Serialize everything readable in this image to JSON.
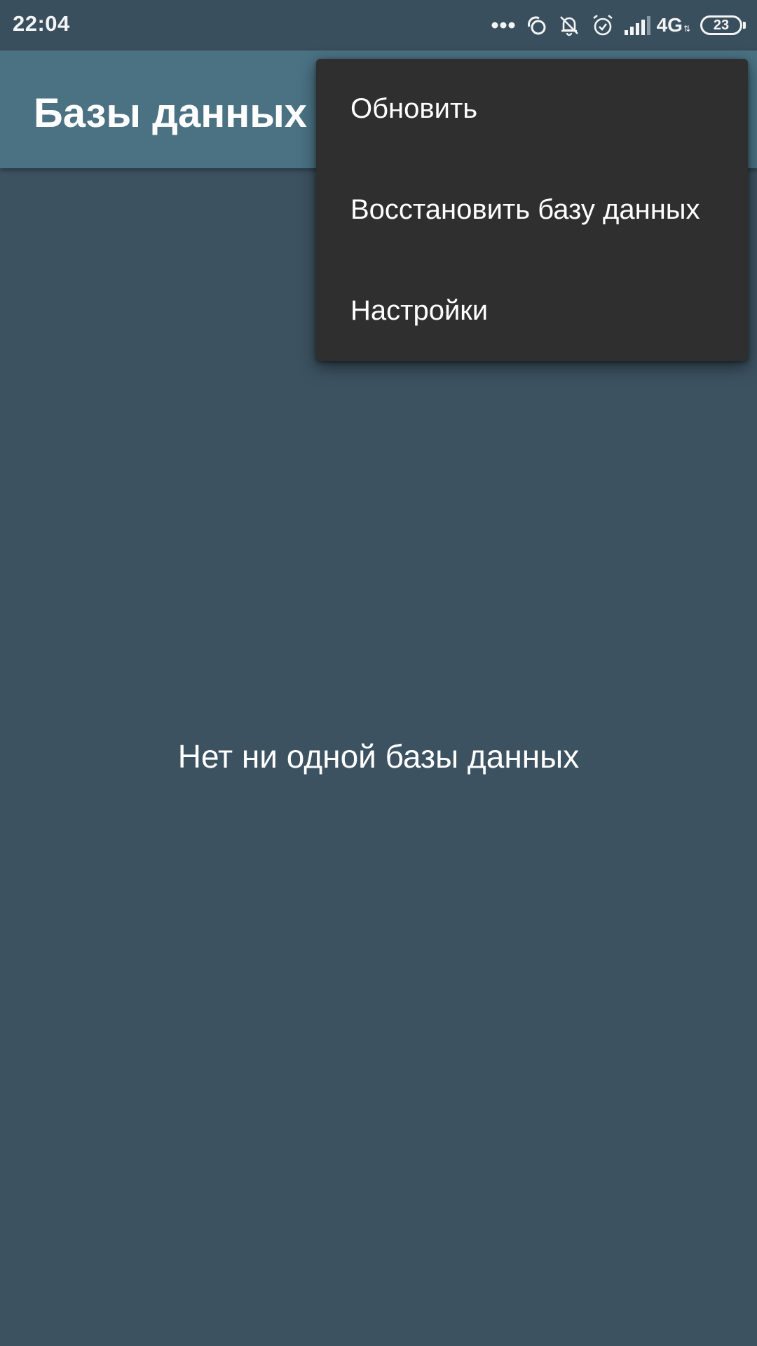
{
  "status_bar": {
    "time": "22:04",
    "icons": [
      "more-dots-icon",
      "sync-icon",
      "bell-off-icon",
      "alarm-icon",
      "signal-icon"
    ],
    "network": "4G",
    "battery_level": "23"
  },
  "app_bar": {
    "title": "Базы данных"
  },
  "overflow_menu": {
    "items": [
      {
        "label": "Обновить"
      },
      {
        "label": "Восстановить базу данных"
      },
      {
        "label": "Настройки"
      }
    ]
  },
  "main": {
    "empty_message": "Нет ни одной базы данных"
  },
  "colors": {
    "background": "#3c5260",
    "status_bar": "#3a4f5d",
    "app_bar": "#4a7283",
    "menu_background": "#2f2f2f",
    "text": "#ffffff"
  }
}
